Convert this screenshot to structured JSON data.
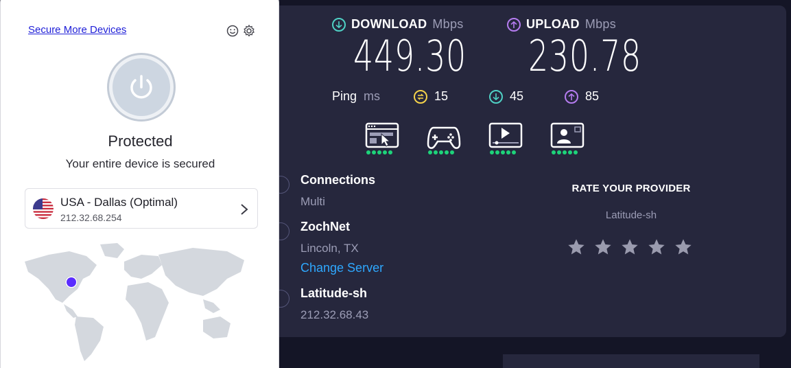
{
  "vpn": {
    "secure_more_devices": "Secure More Devices",
    "status_title": "Protected",
    "status_subtitle": "Your entire device is secured",
    "location": {
      "name": "USA - Dallas (Optimal)",
      "ip": "212.32.68.254"
    },
    "icons": [
      "smiley-icon",
      "gear-icon",
      "power-icon",
      "us-flag-icon",
      "chevron-right-icon"
    ]
  },
  "speedtest": {
    "download": {
      "label": "DOWNLOAD",
      "unit": "Mbps",
      "value": "449.30"
    },
    "upload": {
      "label": "UPLOAD",
      "unit": "Mbps",
      "value": "230.78"
    },
    "ping": {
      "label": "Ping",
      "unit": "ms",
      "idle": "15",
      "download": "45",
      "upload": "85"
    },
    "use_cases": [
      {
        "icon": "web-browsing-icon",
        "rating": 5
      },
      {
        "icon": "gaming-icon",
        "rating": 5
      },
      {
        "icon": "video-streaming-icon",
        "rating": 5
      },
      {
        "icon": "video-call-icon",
        "rating": 5
      }
    ],
    "connections": {
      "title": "Connections",
      "value": "Multi"
    },
    "server": {
      "title": "ZochNet",
      "location": "Lincoln, TX",
      "change_label": "Change Server"
    },
    "provider": {
      "title": "Latitude-sh",
      "ip": "212.32.68.43"
    },
    "rate": {
      "title": "RATE YOUR PROVIDER",
      "provider": "Latitude-sh",
      "stars": 5
    }
  },
  "colors": {
    "background": "#141526",
    "panel": "#26273d",
    "download_accent": "#4fd1c5",
    "upload_accent": "#b57cf0",
    "ping_idle": "#f5d34a",
    "rating_dots": "#1dd37a",
    "link": "#2ea8ff",
    "vpn_link": "#2020d8"
  }
}
